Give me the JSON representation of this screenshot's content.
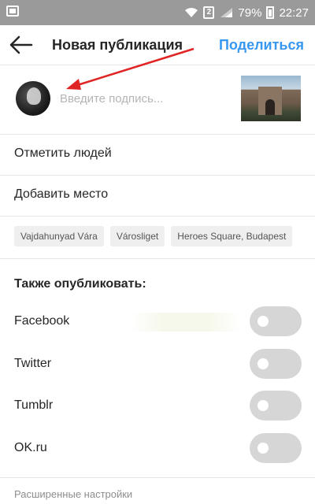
{
  "status_bar": {
    "battery": "79%",
    "time": "22:27",
    "sim_label": "2"
  },
  "header": {
    "title": "Новая публикация",
    "share_label": "Поделиться"
  },
  "caption": {
    "placeholder": "Введите подпись..."
  },
  "rows": {
    "tag_people": "Отметить людей",
    "add_place": "Добавить место"
  },
  "location_suggestions": [
    "Vajdahunyad Vára",
    "Városliget",
    "Heroes Square, Budapest"
  ],
  "also_post": {
    "title": "Также опубликовать:",
    "services": [
      {
        "label": "Facebook",
        "enabled": false
      },
      {
        "label": "Twitter",
        "enabled": false
      },
      {
        "label": "Tumblr",
        "enabled": false
      },
      {
        "label": "OK.ru",
        "enabled": false
      }
    ]
  },
  "advanced_settings": "Расширенные настройки",
  "colors": {
    "accent": "#3897f0",
    "status_bar": "#9a9a9a",
    "annotation_arrow": "#e02424",
    "toggle_off": "#d6d6d6"
  }
}
